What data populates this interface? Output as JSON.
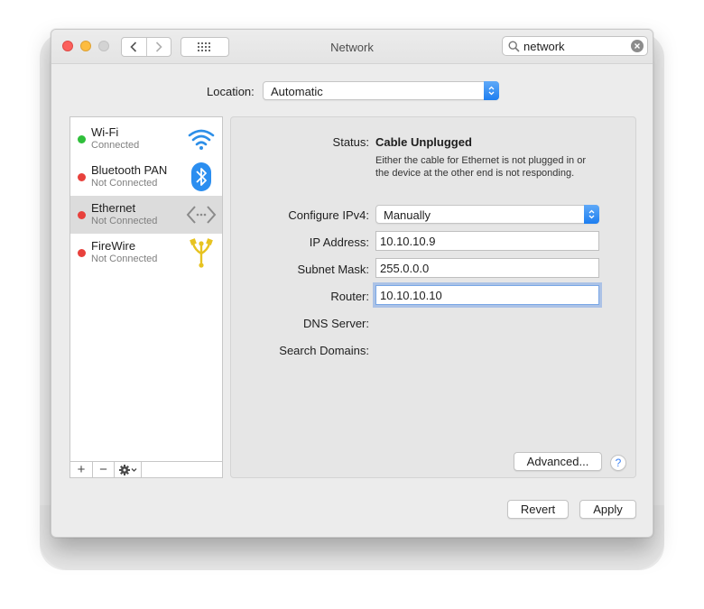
{
  "window": {
    "title": "Network"
  },
  "search": {
    "value": "network"
  },
  "location": {
    "label": "Location:",
    "selected": "Automatic"
  },
  "services": [
    {
      "name": "Wi-Fi",
      "status": "Connected",
      "status_color": "#2fbf3a",
      "icon": "wifi-icon",
      "selected": false
    },
    {
      "name": "Bluetooth PAN",
      "status": "Not Connected",
      "status_color": "#e8413c",
      "icon": "bluetooth-icon",
      "selected": false
    },
    {
      "name": "Ethernet",
      "status": "Not Connected",
      "status_color": "#e8413c",
      "icon": "ethernet-icon",
      "selected": true
    },
    {
      "name": "FireWire",
      "status": "Not Connected",
      "status_color": "#e8413c",
      "icon": "firewire-icon",
      "selected": false
    }
  ],
  "sidebar_toolbar": {
    "add": "+",
    "remove": "−",
    "gear_icon": "gear-icon"
  },
  "detail": {
    "status_label": "Status:",
    "status_value": "Cable Unplugged",
    "status_description": "Either the cable for Ethernet is not plugged in or the device at the other end is not responding.",
    "configure_label": "Configure IPv4:",
    "configure_value": "Manually",
    "ip_label": "IP Address:",
    "ip_value": "10.10.10.9",
    "subnet_label": "Subnet Mask:",
    "subnet_value": "255.0.0.0",
    "router_label": "Router:",
    "router_value": "10.10.10.10",
    "dns_label": "DNS Server:",
    "search_domains_label": "Search Domains:",
    "advanced_button": "Advanced...",
    "help_button": "?"
  },
  "footer": {
    "revert_button": "Revert",
    "apply_button": "Apply"
  },
  "colors": {
    "accent": "#1d7ef0",
    "close": "#fc605c",
    "minimize": "#fdbc40"
  }
}
